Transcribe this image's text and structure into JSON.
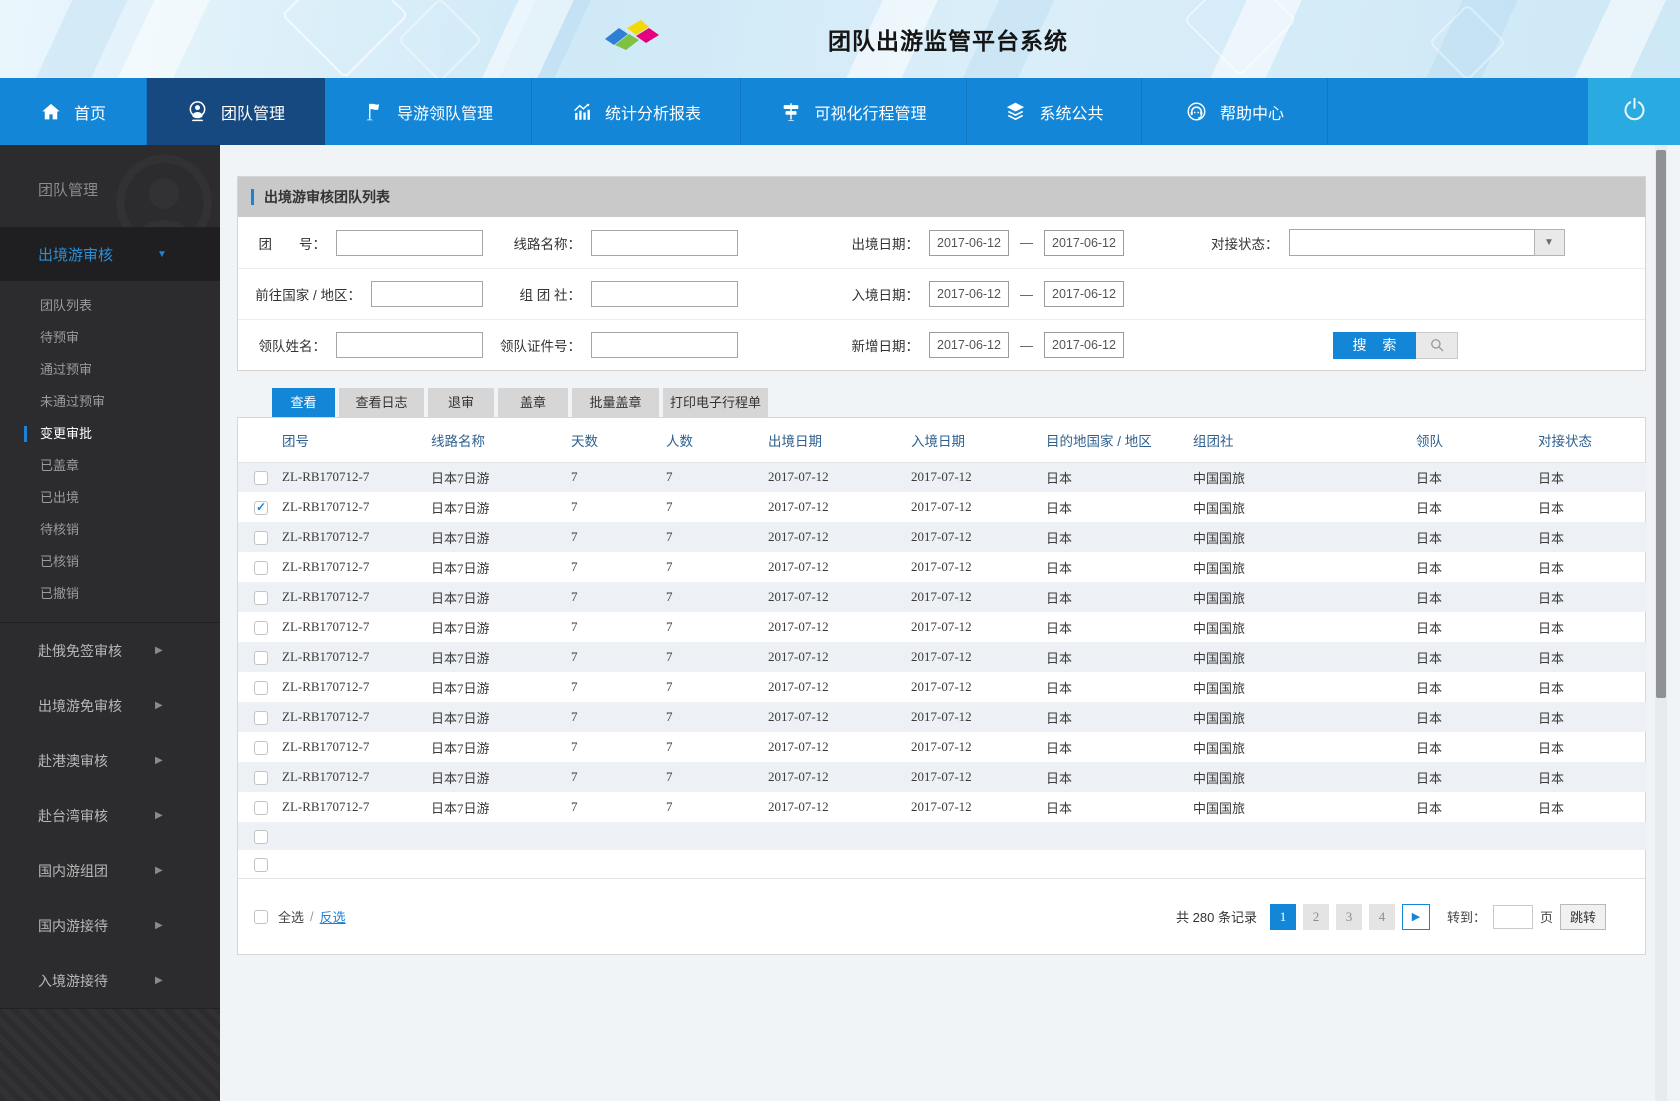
{
  "colors": {
    "accent": "#1b82d6",
    "nav_blue": "#1486d8",
    "nav_active": "#15497f",
    "power_blue": "#29abe2",
    "row_alt": "#edf0f4",
    "table_header_text": "#2f618e",
    "panel_head_bg": "#c9c9c9",
    "sidebar_bg": "#2c2c2e"
  },
  "header": {
    "title": "团队出游监管平台系统",
    "logo_icon": "ribbon-logo"
  },
  "nav": {
    "items": [
      {
        "key": "home",
        "label": "首页",
        "icon": "home-icon",
        "active": false
      },
      {
        "key": "team-mgmt",
        "label": "团队管理",
        "icon": "team-icon",
        "active": true
      },
      {
        "key": "guide-leader-mgmt",
        "label": "导游领队管理",
        "icon": "flag-icon",
        "active": false
      },
      {
        "key": "stats-report",
        "label": "统计分析报表",
        "icon": "chart-icon",
        "active": false
      },
      {
        "key": "visual-trip-mgmt",
        "label": "可视化行程管理",
        "icon": "signpost-icon",
        "active": false
      },
      {
        "key": "system-public",
        "label": "系统公共",
        "icon": "layers-icon",
        "active": false
      },
      {
        "key": "help-center",
        "label": "帮助中心",
        "icon": "headset-icon",
        "active": false
      }
    ],
    "power_icon": "power-icon"
  },
  "sidebar": {
    "section_title": "团队管理",
    "expanded_group": {
      "key": "outbound-review",
      "label": "出境游审核"
    },
    "sub_items": [
      {
        "key": "team-list",
        "label": "团队列表",
        "active": false
      },
      {
        "key": "pre-review-pending",
        "label": "待预审",
        "active": false
      },
      {
        "key": "pre-review-passed",
        "label": "通过预审",
        "active": false
      },
      {
        "key": "pre-review-failed",
        "label": "未通过预审",
        "active": false
      },
      {
        "key": "change-approval",
        "label": "变更审批",
        "active": true
      },
      {
        "key": "stamped",
        "label": "已盖章",
        "active": false
      },
      {
        "key": "exited",
        "label": "已出境",
        "active": false
      },
      {
        "key": "pending-writeoff",
        "label": "待核销",
        "active": false
      },
      {
        "key": "written-off",
        "label": "已核销",
        "active": false
      },
      {
        "key": "revoked",
        "label": "已撤销",
        "active": false
      }
    ],
    "collapsed_groups": [
      {
        "key": "russia-visa-free",
        "label": "赴俄免签审核"
      },
      {
        "key": "outbound-exempt",
        "label": "出境游免审核"
      },
      {
        "key": "hk-macau-review",
        "label": "赴港澳审核"
      },
      {
        "key": "taiwan-review",
        "label": "赴台湾审核"
      },
      {
        "key": "domestic-group",
        "label": "国内游组团"
      },
      {
        "key": "domestic-reception",
        "label": "国内游接待"
      },
      {
        "key": "inbound-reception",
        "label": "入境游接待"
      }
    ]
  },
  "panel": {
    "title": "出境游审核团队列表"
  },
  "search_form": {
    "rows": [
      {
        "fields": [
          {
            "key": "group-no",
            "label": "团　　号：",
            "type": "text",
            "value": ""
          },
          {
            "key": "route-name",
            "label": "线路名称：",
            "type": "text",
            "value": ""
          },
          {
            "key": "exit-date",
            "label": "出境日期：",
            "type": "daterange",
            "from": "2017-06-12",
            "to": "2017-06-12",
            "dash": "—"
          },
          {
            "key": "dock-status",
            "label": "对接状态：",
            "type": "select",
            "value": ""
          }
        ]
      },
      {
        "fields": [
          {
            "key": "dest-country",
            "label": "前往国家 / 地区：",
            "type": "text",
            "value": "",
            "narrow": true
          },
          {
            "key": "organizer",
            "label": "组 团 社：",
            "type": "text",
            "value": ""
          },
          {
            "key": "entry-date",
            "label": "入境日期：",
            "type": "daterange",
            "from": "2017-06-12",
            "to": "2017-06-12",
            "dash": "—"
          }
        ]
      },
      {
        "fields": [
          {
            "key": "leader-name",
            "label": "领队姓名：",
            "type": "text",
            "value": ""
          },
          {
            "key": "leader-id",
            "label": "领队证件号：",
            "type": "text",
            "value": ""
          },
          {
            "key": "add-date",
            "label": "新增日期：",
            "type": "daterange",
            "from": "2017-06-12",
            "to": "2017-06-12",
            "dash": "—"
          },
          {
            "key": "search",
            "type": "search",
            "label": "搜 索",
            "icon": "magnifier-icon"
          }
        ]
      }
    ]
  },
  "tabs": [
    {
      "key": "view",
      "label": "查看",
      "active": true
    },
    {
      "key": "view-log",
      "label": "查看日志",
      "active": false
    },
    {
      "key": "reject",
      "label": "退审",
      "active": false
    },
    {
      "key": "stamp",
      "label": "盖章",
      "active": false
    },
    {
      "key": "batch-stamp",
      "label": "批量盖章",
      "active": false
    },
    {
      "key": "print-itinerary",
      "label": "打印电子行程单",
      "active": false
    }
  ],
  "table": {
    "columns": [
      "团号",
      "线路名称",
      "天数",
      "人数",
      "出境日期",
      "入境日期",
      "目的地国家 / 地区",
      "组团社",
      "领队",
      "对接状态"
    ],
    "column_keys": [
      "group-no",
      "route-name",
      "days",
      "people",
      "exit-date",
      "entry-date",
      "destination",
      "organizer",
      "leader",
      "dock-status"
    ],
    "rows": [
      {
        "checked": false,
        "cells": [
          "ZL-RB170712-7",
          "日本7日游",
          "7",
          "7",
          "2017-07-12",
          "2017-07-12",
          "日本",
          "中国国旅",
          "日本",
          "日本"
        ]
      },
      {
        "checked": true,
        "cells": [
          "ZL-RB170712-7",
          "日本7日游",
          "7",
          "7",
          "2017-07-12",
          "2017-07-12",
          "日本",
          "中国国旅",
          "日本",
          "日本"
        ]
      },
      {
        "checked": false,
        "cells": [
          "ZL-RB170712-7",
          "日本7日游",
          "7",
          "7",
          "2017-07-12",
          "2017-07-12",
          "日本",
          "中国国旅",
          "日本",
          "日本"
        ]
      },
      {
        "checked": false,
        "cells": [
          "ZL-RB170712-7",
          "日本7日游",
          "7",
          "7",
          "2017-07-12",
          "2017-07-12",
          "日本",
          "中国国旅",
          "日本",
          "日本"
        ]
      },
      {
        "checked": false,
        "cells": [
          "ZL-RB170712-7",
          "日本7日游",
          "7",
          "7",
          "2017-07-12",
          "2017-07-12",
          "日本",
          "中国国旅",
          "日本",
          "日本"
        ]
      },
      {
        "checked": false,
        "cells": [
          "ZL-RB170712-7",
          "日本7日游",
          "7",
          "7",
          "2017-07-12",
          "2017-07-12",
          "日本",
          "中国国旅",
          "日本",
          "日本"
        ]
      },
      {
        "checked": false,
        "cells": [
          "ZL-RB170712-7",
          "日本7日游",
          "7",
          "7",
          "2017-07-12",
          "2017-07-12",
          "日本",
          "中国国旅",
          "日本",
          "日本"
        ]
      },
      {
        "checked": false,
        "cells": [
          "ZL-RB170712-7",
          "日本7日游",
          "7",
          "7",
          "2017-07-12",
          "2017-07-12",
          "日本",
          "中国国旅",
          "日本",
          "日本"
        ]
      },
      {
        "checked": false,
        "cells": [
          "ZL-RB170712-7",
          "日本7日游",
          "7",
          "7",
          "2017-07-12",
          "2017-07-12",
          "日本",
          "中国国旅",
          "日本",
          "日本"
        ]
      },
      {
        "checked": false,
        "cells": [
          "ZL-RB170712-7",
          "日本7日游",
          "7",
          "7",
          "2017-07-12",
          "2017-07-12",
          "日本",
          "中国国旅",
          "日本",
          "日本"
        ]
      },
      {
        "checked": false,
        "cells": [
          "ZL-RB170712-7",
          "日本7日游",
          "7",
          "7",
          "2017-07-12",
          "2017-07-12",
          "日本",
          "中国国旅",
          "日本",
          "日本"
        ]
      },
      {
        "checked": false,
        "cells": [
          "ZL-RB170712-7",
          "日本7日游",
          "7",
          "7",
          "2017-07-12",
          "2017-07-12",
          "日本",
          "中国国旅",
          "日本",
          "日本"
        ]
      }
    ],
    "empty_rows": 2
  },
  "footer": {
    "select_all": "全选",
    "separator": "/",
    "invert_label": "反选",
    "total_prefix": "共",
    "total_count": "280",
    "total_suffix": "条记录",
    "pages": [
      "1",
      "2",
      "3",
      "4"
    ],
    "active_page": "1",
    "next_icon": "next-page-icon",
    "goto_label": "转到：",
    "goto_value": "",
    "goto_unit": "页",
    "jump_label": "跳转"
  }
}
